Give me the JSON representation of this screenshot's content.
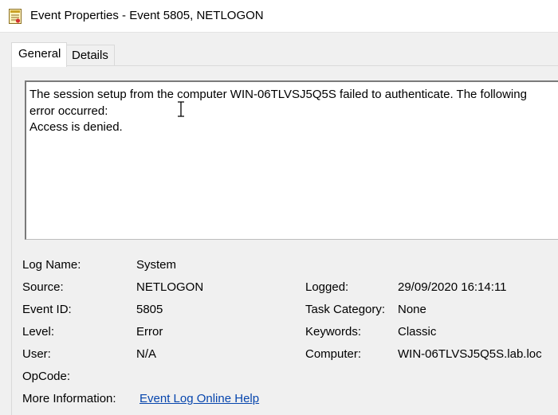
{
  "window": {
    "title": "Event Properties - Event 5805, NETLOGON",
    "app_icon": "event-viewer-icon"
  },
  "tabs": [
    {
      "label": "General",
      "active": true
    },
    {
      "label": "Details",
      "active": false
    }
  ],
  "description": "The session setup from the computer WIN-06TLVSJ5Q5S failed to authenticate. The following\nerror occurred:\nAccess is denied.",
  "fields": {
    "log_name": {
      "label": "Log Name:",
      "value": "System"
    },
    "source": {
      "label": "Source:",
      "value": "NETLOGON"
    },
    "event_id": {
      "label": "Event ID:",
      "value": "5805"
    },
    "level": {
      "label": "Level:",
      "value": "Error"
    },
    "user": {
      "label": "User:",
      "value": "N/A"
    },
    "opcode": {
      "label": "OpCode:",
      "value": ""
    },
    "more_info": {
      "label": "More Information:",
      "link": "Event Log Online Help"
    },
    "logged": {
      "label": "Logged:",
      "value": "29/09/2020 16:14:11"
    },
    "task_category": {
      "label": "Task Category:",
      "value": "None"
    },
    "keywords": {
      "label": "Keywords:",
      "value": "Classic"
    },
    "computer": {
      "label": "Computer:",
      "value": "WIN-06TLVSJ5Q5S.lab.loc"
    }
  },
  "colors": {
    "link": "#0645ad",
    "border": "#7a7a7a"
  }
}
